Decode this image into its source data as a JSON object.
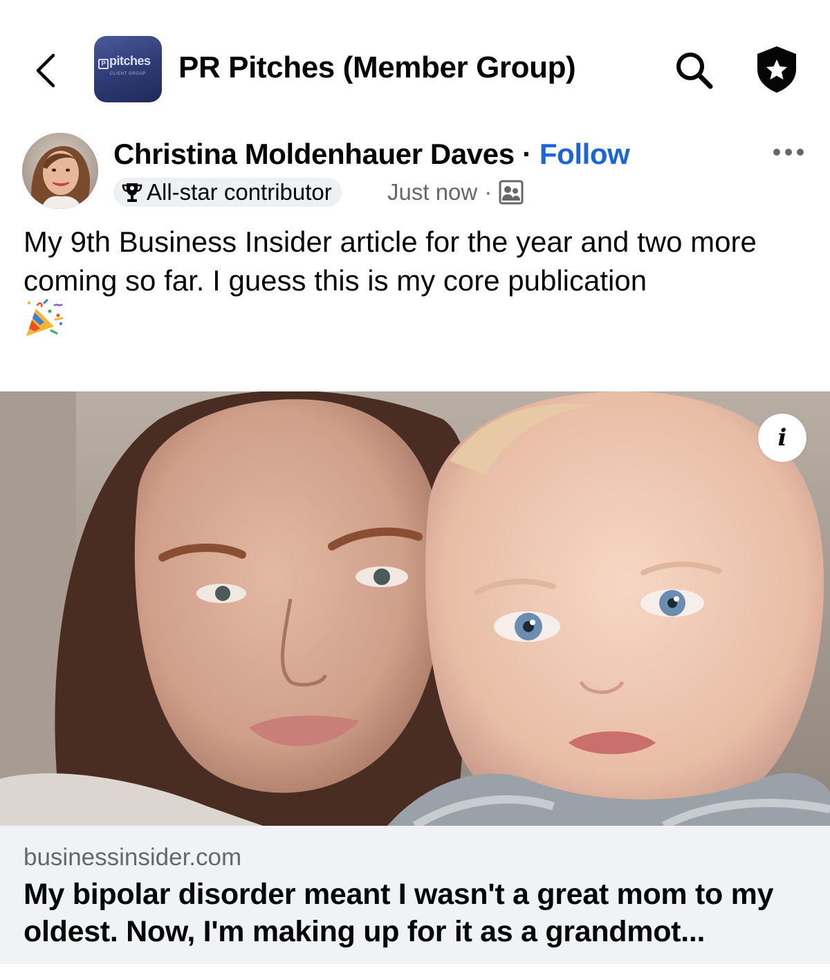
{
  "header": {
    "back_icon": "chevron-left-icon",
    "group_logo_text": "pitches",
    "group_logo_subtext": "CLIENT GROUP",
    "group_title": "PR Pitches (Member Group)",
    "search_icon": "search-icon",
    "shield_icon": "shield-star-icon"
  },
  "post": {
    "author_name": "Christina Moldenhauer Daves",
    "separator": "·",
    "follow_label": "Follow",
    "more_icon": "more-horizontal-icon",
    "badge_icon": "trophy-icon",
    "badge_label": "All-star contributor",
    "timestamp": "Just now",
    "meta_dot": "·",
    "audience_icon": "group-members-icon",
    "text": "My 9th Business Insider article for the year and two more coming so far. I guess this is my core publication",
    "emoji": "party-popper-emoji"
  },
  "link_preview": {
    "info_label": "i",
    "domain": "businessinsider.com",
    "title": "My bipolar disorder meant I wasn't a great mom to my oldest. Now, I'm making up for it as a grandmot..."
  },
  "colors": {
    "link_blue": "#1b65d8",
    "secondary_text": "#65676b",
    "card_background": "#f0f2f5",
    "badge_background": "#eef0f3"
  }
}
